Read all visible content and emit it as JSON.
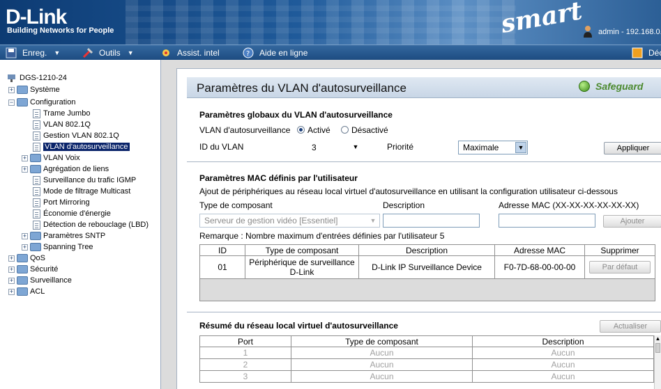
{
  "header": {
    "logo": "D-Link",
    "tagline": "Building Networks for People",
    "product": "smart",
    "user": "admin - 192.168.0."
  },
  "toolbar": {
    "items": [
      {
        "label": "Enreg."
      },
      {
        "label": "Outils"
      },
      {
        "label": "Assist. intel"
      },
      {
        "label": "Aide en ligne"
      },
      {
        "label": "Déc"
      }
    ]
  },
  "tree": {
    "root": "DGS-1210-24",
    "items": [
      {
        "label": "Système"
      },
      {
        "label": "Configuration"
      },
      {
        "label": "Trame Jumbo"
      },
      {
        "label": "VLAN 802.1Q"
      },
      {
        "label": "Gestion VLAN 802.1Q"
      },
      {
        "label": "VLAN d'autosurveillance"
      },
      {
        "label": "VLAN Voix"
      },
      {
        "label": "Agrégation de liens"
      },
      {
        "label": "Surveillance du trafic IGMP"
      },
      {
        "label": "Mode de filtrage Multicast"
      },
      {
        "label": "Port Mirroring"
      },
      {
        "label": "Économie d'énergie"
      },
      {
        "label": "Détection de rebouclage (LBD)"
      },
      {
        "label": "Paramètres SNTP"
      },
      {
        "label": "Spanning Tree"
      },
      {
        "label": "QoS"
      },
      {
        "label": "Sécurité"
      },
      {
        "label": "Surveillance"
      },
      {
        "label": "ACL"
      }
    ]
  },
  "page": {
    "title": "Paramètres du VLAN d'autosurveillance",
    "safeguard": "Safeguard",
    "global": {
      "heading": "Paramètres globaux du VLAN d'autosurveillance",
      "vlan_label": "VLAN d'autosurveillance",
      "enabled": "Activé",
      "disabled": "Désactivé",
      "vid_label": "ID du VLAN",
      "vid_value": "3",
      "priority_label": "Priorité",
      "priority_value": "Maximale",
      "apply": "Appliquer"
    },
    "mac": {
      "heading": "Paramètres MAC définis par l'utilisateur",
      "desc": "Ajout de périphériques au réseau local virtuel d'autosurveillance en utilisant la configuration utilisateur ci-dessous",
      "type_label": "Type de composant",
      "desc_label": "Description",
      "mac_label": "Adresse MAC (XX-XX-XX-XX-XX-XX)",
      "type_value": "Serveur de gestion vidéo [Essentiel]",
      "add": "Ajouter",
      "remark": "Remarque : Nombre maximum d'entrées définies par l'utilisateur 5",
      "columns": [
        "ID",
        "Type de composant",
        "Description",
        "Adresse MAC",
        "Supprimer"
      ],
      "rows": [
        {
          "id": "01",
          "type_l1": "Périphérique de surveillance",
          "type_l2": "D-Link",
          "desc": "D-Link IP Surveillance Device",
          "mac": "F0-7D-68-00-00-00",
          "action": "Par défaut"
        }
      ]
    },
    "summary": {
      "heading": "Résumé du réseau local virtuel d'autosurveillance",
      "refresh": "Actualiser",
      "columns": [
        "Port",
        "Type de composant",
        "Description"
      ],
      "rows": [
        {
          "port": "1",
          "type": "Aucun",
          "desc": "Aucun"
        },
        {
          "port": "2",
          "type": "Aucun",
          "desc": "Aucun"
        },
        {
          "port": "3",
          "type": "Aucun",
          "desc": "Aucun"
        }
      ]
    }
  }
}
